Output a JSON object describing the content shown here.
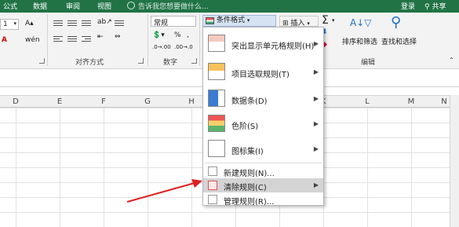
{
  "tabs": {
    "formulas": "公式",
    "data": "数据",
    "review": "审阅",
    "view": "视图",
    "tell_me": "告诉我您想要做什么...",
    "login": "登录",
    "share": "共享"
  },
  "ribbon": {
    "font_size": "1",
    "number_format": "常规",
    "percent": "%",
    "comma": ",",
    "conditional_format": "条件格式",
    "insert": "插入",
    "sort_filter": "排序和筛选",
    "find_select": "查找和选择",
    "groups": {
      "alignment": "对齐方式",
      "number": "数字",
      "editing": "编辑"
    }
  },
  "columns": [
    "D",
    "E",
    "F",
    "G",
    "H",
    "I",
    "J",
    "K",
    "L",
    "M",
    "N"
  ],
  "menu": {
    "items": [
      {
        "label": "突出显示单元格规则(H)",
        "icon": "highlight-cells-icon"
      },
      {
        "label": "项目选取规则(T)",
        "icon": "top-bottom-rules-icon"
      },
      {
        "label": "数据条(D)",
        "icon": "data-bars-icon"
      },
      {
        "label": "色阶(S)",
        "icon": "color-scales-icon"
      },
      {
        "label": "图标集(I)",
        "icon": "icon-sets-icon"
      },
      {
        "label": "新建规则(N)...",
        "icon": "new-rule-icon"
      },
      {
        "label": "清除规则(C)",
        "icon": "clear-rules-icon"
      },
      {
        "label": "管理规则(R)...",
        "icon": "manage-rules-icon"
      }
    ],
    "highlighted_index": 6
  },
  "colors": {
    "brand": "#217346",
    "highlight": "#d4d4d4",
    "arrow": "#e02020"
  }
}
